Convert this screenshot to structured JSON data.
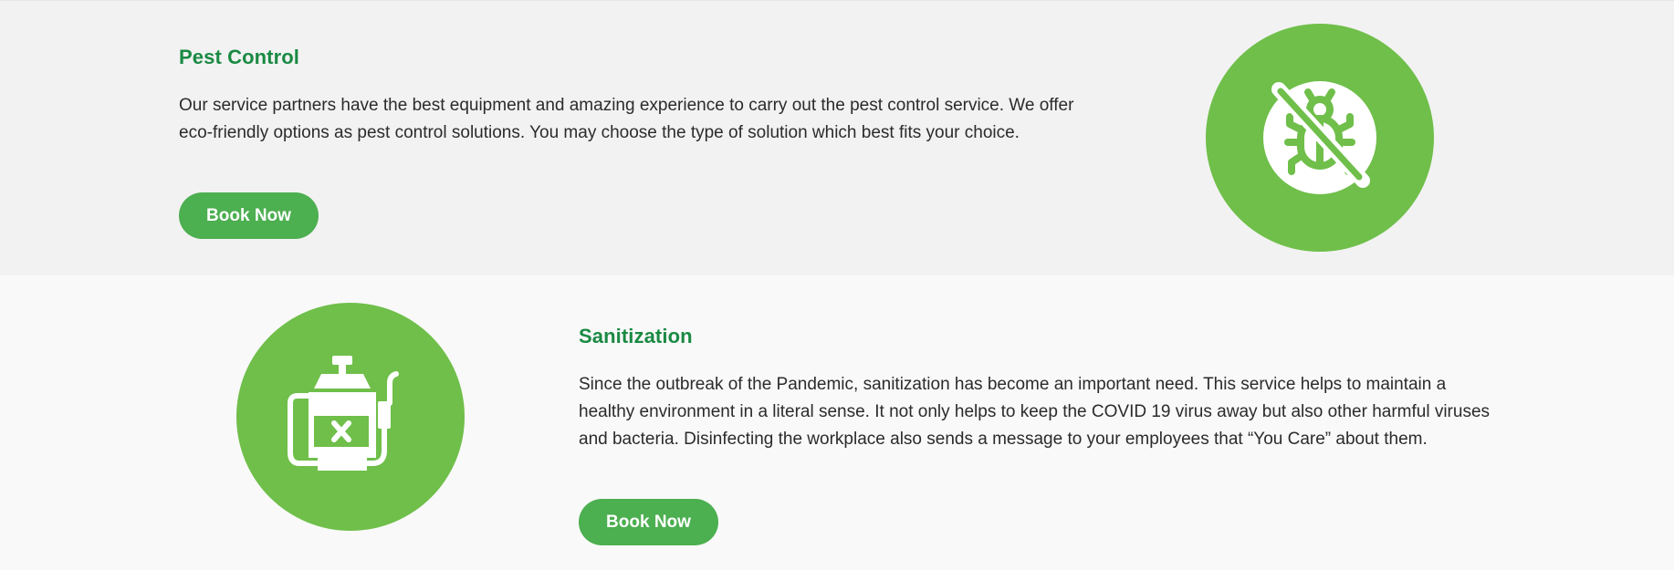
{
  "services": [
    {
      "title": "Pest Control",
      "description": "Our service partners have the best equipment and amazing experience to carry out the pest control service. We offer eco-friendly options as pest control solutions. You may choose the type of solution which best fits your choice.",
      "button_label": "Book Now",
      "icon": "no-bug-icon"
    },
    {
      "title": "Sanitization",
      "description": "Since the outbreak of the Pandemic, sanitization has become an important need. This service helps to maintain a healthy environment in a literal sense. It not only helps to keep the COVID 19 virus away but also other harmful viruses and bacteria. Disinfecting the workplace also sends a message to your employees that “You Care” about them.",
      "button_label": "Book Now",
      "icon": "sprayer-icon"
    }
  ],
  "colors": {
    "heading": "#1a8a43",
    "button": "#4caf50",
    "icon_circle": "#6fbf4a",
    "section_bg_1": "#f2f2f2",
    "section_bg_2": "#f9f9f9",
    "text": "#2b2b2b"
  }
}
